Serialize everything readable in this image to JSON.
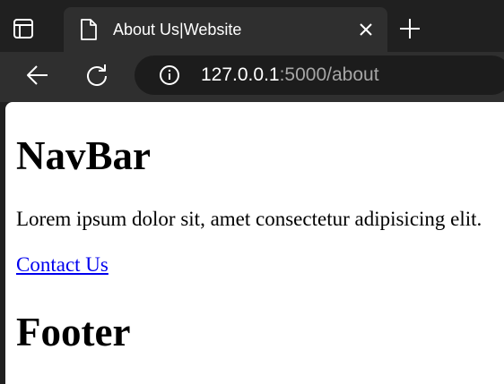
{
  "browser": {
    "tab": {
      "title": "About Us|Website"
    },
    "address": {
      "host": "127.0.0.1",
      "path": ":5000/about"
    },
    "icons": {
      "tab_actions": "tab-actions-icon",
      "favicon": "page-icon",
      "close": "close-icon",
      "new_tab": "plus-icon",
      "back": "back-arrow-icon",
      "reload": "reload-icon",
      "site_info": "info-icon"
    }
  },
  "page": {
    "navbar_heading": "NavBar",
    "body_text": "Lorem ipsum dolor sit, amet consectetur adipisicing elit.",
    "contact_link": "Contact Us",
    "footer_heading": "Footer"
  },
  "colors": {
    "chrome_dark": "#202020",
    "chrome_tab": "#2f2f2f",
    "link": "#0000ee"
  }
}
